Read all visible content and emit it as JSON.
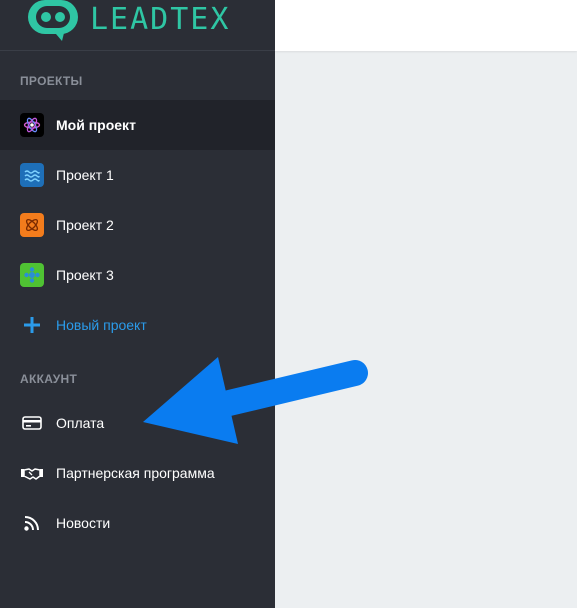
{
  "logo": {
    "text": "LEADTEX"
  },
  "sidebar": {
    "projects_title": "ПРОЕКТЫ",
    "projects": [
      {
        "label": "Мой проект",
        "icon": "atom-icon",
        "color": "#000000",
        "active": true
      },
      {
        "label": "Проект 1",
        "icon": "waves-icon",
        "color": "#1e6fb8"
      },
      {
        "label": "Проект 2",
        "icon": "flower-icon",
        "color": "#f37c1c"
      },
      {
        "label": "Проект 3",
        "icon": "snowflake-icon",
        "color": "#4fc233"
      }
    ],
    "new_project": "Новый проект",
    "account_title": "АККАУНТ",
    "account": [
      {
        "label": "Оплата",
        "icon": "credit-card-icon"
      },
      {
        "label": "Партнерская программа",
        "icon": "handshake-icon"
      },
      {
        "label": "Новости",
        "icon": "rss-icon"
      }
    ]
  },
  "colors": {
    "sidebar_bg": "#2b2e36",
    "active_bg": "#21232a",
    "accent": "#2b9bea",
    "arrow": "#0a7cf0",
    "content_bg": "#eceff1"
  }
}
